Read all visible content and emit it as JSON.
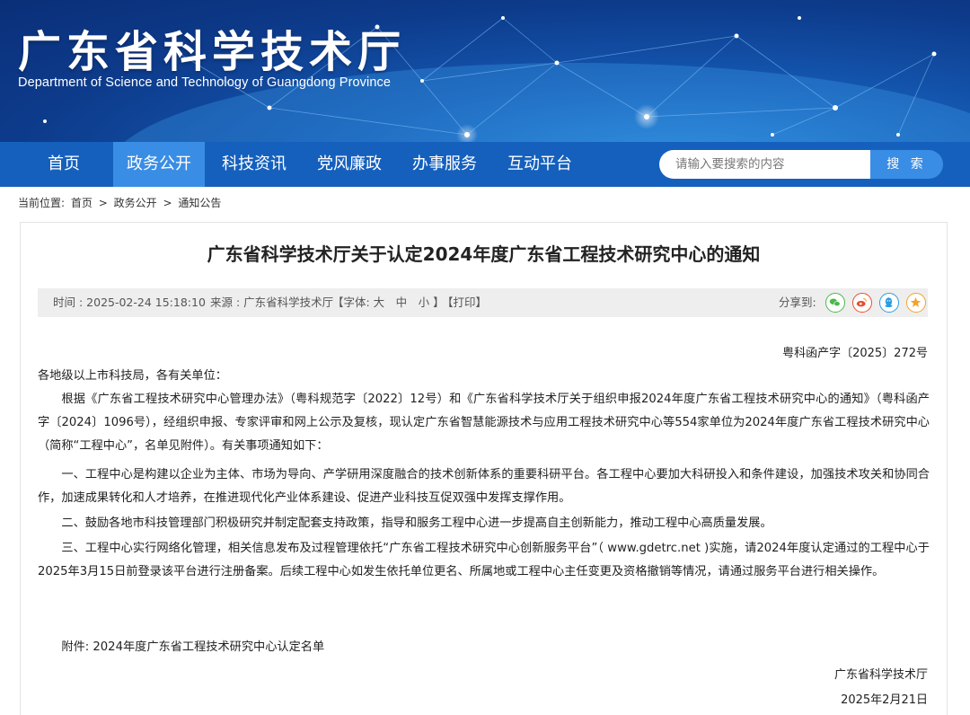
{
  "header": {
    "title": "广东省科学技术厅",
    "subtitle": "Department of Science and Technology of Guangdong Province"
  },
  "nav": {
    "items": [
      "首页",
      "政务公开",
      "科技资讯",
      "党风廉政",
      "办事服务",
      "互动平台"
    ],
    "active": "政务公开"
  },
  "search": {
    "placeholder": "请输入要搜索的内容",
    "button": "搜 索"
  },
  "breadcrumb": {
    "label": "当前位置:",
    "items": [
      "首页",
      "政务公开",
      "通知公告"
    ],
    "separator": ">"
  },
  "article": {
    "title": "广东省科学技术厅关于认定2024年度广东省工程技术研究中心的通知",
    "meta": {
      "time": "时间 : 2025-02-24 15:18:10",
      "source": "来源 : 广东省科学技术厅",
      "font": "【字体: 大　中　小 】",
      "print": "【打印】",
      "share": "分享到:"
    },
    "doc_number": "粤科函产字〔2025〕272号",
    "salutation": "各地级以上市科技局，各有关单位：",
    "paragraphs": [
      "根据《广东省工程技术研究中心管理办法》（粤科规范字〔2022〕12号）和《广东省科学技术厅关于组织申报2024年度广东省工程技术研究中心的通知》（粤科函产字〔2024〕1096号），经组织申报、专家评审和网上公示及复核，现认定广东省智慧能源技术与应用工程技术研究中心等554家单位为2024年度广东省工程技术研究中心（简称“工程中心”，名单见附件）。有关事项通知如下：",
      "一、工程中心是构建以企业为主体、市场为导向、产学研用深度融合的技术创新体系的重要科研平台。各工程中心要加大科研投入和条件建设，加强技术攻关和协同合作，加速成果转化和人才培养，在推进现代化产业体系建设、促进产业科技互促双强中发挥支撑作用。",
      "二、鼓励各地市科技管理部门积极研究并制定配套支持政策，指导和服务工程中心进一步提高自主创新能力，推动工程中心高质量发展。",
      "三、工程中心实行网络化管理，相关信息发布及过程管理依托“广东省工程技术研究中心创新服务平台”（ www.gdetrc.net )实施，请2024年度认定通过的工程中心于2025年3月15日前登录该平台进行注册备案。后续工程中心如发生依托单位更名、所属地或工程中心主任变更及资格撤销等情况，请通过服务平台进行相关操作。"
    ],
    "attachment": "附件: 2024年度广东省工程技术研究中心认定名单",
    "signature": "广东省科学技术厅",
    "date": "2025年2月21日"
  },
  "icons": {
    "share": [
      "wechat-icon",
      "weibo-icon",
      "qq-icon",
      "qzone-icon"
    ]
  },
  "colors": {
    "nav_bg": "#1560bd",
    "nav_active": "#3a8de4",
    "wechat": "#4cb848",
    "weibo": "#e6502e",
    "qq": "#2b9de3",
    "qzone": "#f2a42a"
  }
}
